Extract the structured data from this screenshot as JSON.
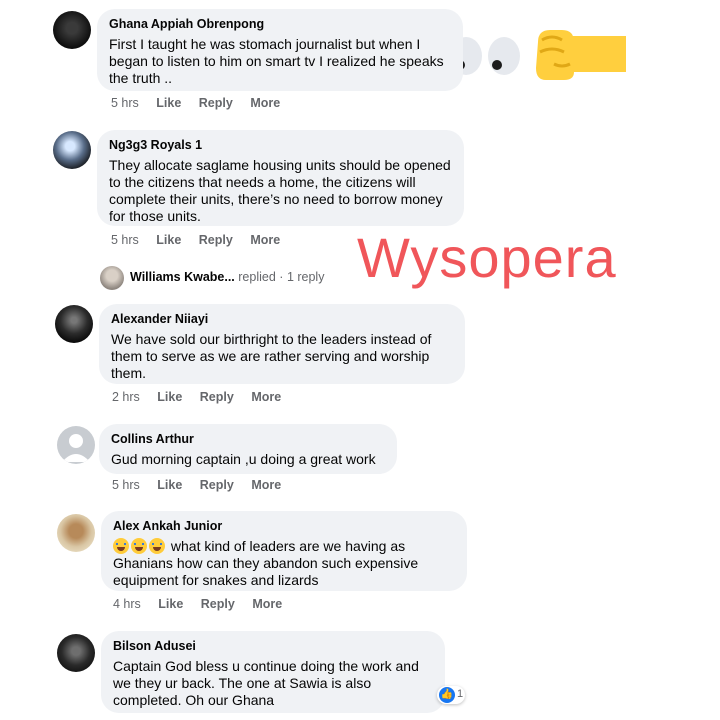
{
  "watermark": "Wysopera",
  "actions": {
    "like": "Like",
    "reply": "Reply",
    "more": "More"
  },
  "comments": [
    {
      "author": "Ghana Appiah Obrenpong",
      "text": "First I taught he was stomach journalist but when I began to listen to him on smart tv I realized he speaks the truth ..",
      "time": "5 hrs"
    },
    {
      "author": "Ng3g3 Royals 1",
      "text": "They allocate saglame housing units should be opened to the citizens that needs a home, the citizens will complete their units, there’s no need to borrow money for those units.",
      "time": "5 hrs"
    },
    {
      "author": "Alexander Niiayi",
      "text": "We have sold our birthright to the leaders instead of them to serve as we are rather serving and worship them.",
      "time": "2 hrs"
    },
    {
      "author": "Collins Arthur",
      "text": "Gud morning captain ,u doing a great work",
      "time": "5 hrs"
    },
    {
      "author": "Alex Ankah Junior",
      "text": "what kind of leaders are we having as Ghanians how can they abandon such expensive equipment for snakes and lizards",
      "time": "4 hrs"
    },
    {
      "author": "Bilson Adusei",
      "text": "Captain God bless u continue doing the work and we they ur back. The one at Sawia is also completed. Oh our Ghana",
      "time": ""
    }
  ],
  "reply_thread": {
    "author": "Williams Kwabe...",
    "verb": "replied",
    "separator": "·",
    "count": "1 reply"
  },
  "reaction": {
    "icon": "like-icon",
    "count": "1"
  }
}
